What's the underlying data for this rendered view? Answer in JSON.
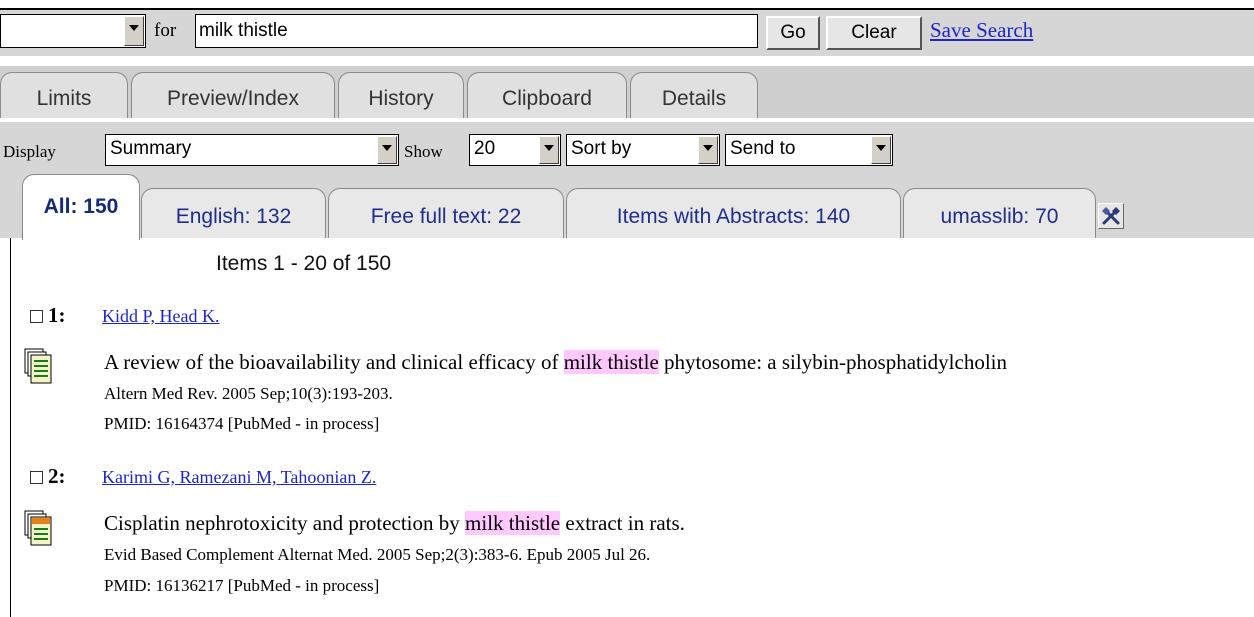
{
  "search": {
    "db_select_value": "",
    "for_label": "for",
    "query": "milk thistle",
    "go_label": "Go",
    "clear_label": "Clear",
    "save_label": "Save Search"
  },
  "nav_tabs": [
    "Limits",
    "Preview/Index",
    "History",
    "Clipboard",
    "Details"
  ],
  "display_bar": {
    "display_label": "Display",
    "display_value": "Summary",
    "show_label": "Show",
    "show_value": "20",
    "sort_value": "Sort by",
    "send_value": "Send to"
  },
  "filter_tabs": [
    {
      "label": "All: 150",
      "active": true
    },
    {
      "label": "English: 132",
      "active": false
    },
    {
      "label": "Free full text: 22",
      "active": false
    },
    {
      "label": "Items with Abstracts: 140",
      "active": false
    },
    {
      "label": "umasslib: 70",
      "active": false
    }
  ],
  "results": {
    "count_text": "Items 1 - 20 of 150",
    "items": [
      {
        "num": "1:",
        "authors": "Kidd P, Head K.",
        "title_before": "A review of the bioavailability and clinical efficacy of ",
        "title_highlight": "milk thistle",
        "title_after": " phytosome: a silybin-phosphatidylcholin",
        "citation": "Altern Med Rev. 2005 Sep;10(3):193-203.",
        "pmid": "PMID: 16164374 [PubMed - in process]",
        "icon": "abstract-document-icon"
      },
      {
        "num": "2:",
        "authors": "Karimi G, Ramezani M, Tahoonian Z.",
        "title_before": "Cisplatin nephrotoxicity and protection by ",
        "title_highlight": "milk thistle",
        "title_after": " extract in rats.",
        "citation": "Evid Based Complement Alternat Med. 2005 Sep;2(3):383-6. Epub 2005 Jul 26.",
        "pmid": "PMID: 16136217 [PubMed - in process]",
        "icon": "free-full-text-document-icon"
      }
    ]
  },
  "colors": {
    "highlight": "#ffc8ff",
    "link": "#1e25c8",
    "bar_gray": "#d6d6d6",
    "tab_text": "#1f2e8c"
  }
}
